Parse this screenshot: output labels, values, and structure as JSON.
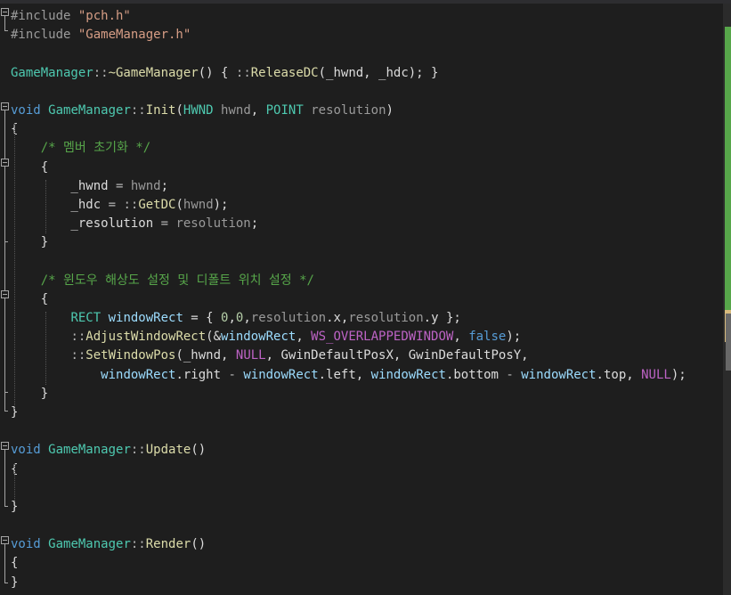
{
  "lines": [
    [
      [
        "t-pre",
        "#include "
      ],
      [
        "t-str",
        "\"pch.h\""
      ]
    ],
    [
      [
        "t-pre",
        "#include "
      ],
      [
        "t-str",
        "\"GameManager.h\""
      ]
    ],
    [],
    [
      [
        "t-type",
        "GameManager"
      ],
      [
        "t-op",
        "::"
      ],
      [
        "t-func",
        "~GameManager"
      ],
      [
        "t-def",
        "() { "
      ],
      [
        "t-op",
        "::"
      ],
      [
        "t-func",
        "ReleaseDC"
      ],
      [
        "t-def",
        "(_hwnd, _hdc); }"
      ]
    ],
    [],
    [
      [
        "t-kw",
        "void "
      ],
      [
        "t-type",
        "GameManager"
      ],
      [
        "t-op",
        "::"
      ],
      [
        "t-func",
        "Init"
      ],
      [
        "t-def",
        "("
      ],
      [
        "t-type",
        "HWND"
      ],
      [
        "t-param",
        " hwnd"
      ],
      [
        "t-def",
        ", "
      ],
      [
        "t-type",
        "POINT"
      ],
      [
        "t-param",
        " resolution"
      ],
      [
        "t-def",
        ")"
      ]
    ],
    [
      [
        "t-def",
        "{"
      ]
    ],
    [
      [
        "t-def",
        "    "
      ],
      [
        "t-cmt",
        "/* 멤버 초기화 */"
      ]
    ],
    [
      [
        "t-def",
        "    {"
      ]
    ],
    [
      [
        "t-def",
        "        _hwnd "
      ],
      [
        "t-op",
        "="
      ],
      [
        "t-param",
        " hwnd"
      ],
      [
        "t-def",
        ";"
      ]
    ],
    [
      [
        "t-def",
        "        _hdc "
      ],
      [
        "t-op",
        "="
      ],
      [
        "t-def",
        " "
      ],
      [
        "t-op",
        "::"
      ],
      [
        "t-func",
        "GetDC"
      ],
      [
        "t-def",
        "("
      ],
      [
        "t-param",
        "hwnd"
      ],
      [
        "t-def",
        ");"
      ]
    ],
    [
      [
        "t-def",
        "        _resolution "
      ],
      [
        "t-op",
        "="
      ],
      [
        "t-param",
        " resolution"
      ],
      [
        "t-def",
        ";"
      ]
    ],
    [
      [
        "t-def",
        "    }"
      ]
    ],
    [],
    [
      [
        "t-def",
        "    "
      ],
      [
        "t-cmt",
        "/* 윈도우 해상도 설정 및 디폴트 위치 설정 */"
      ]
    ],
    [
      [
        "t-def",
        "    {"
      ]
    ],
    [
      [
        "t-def",
        "        "
      ],
      [
        "t-type",
        "RECT"
      ],
      [
        "t-var",
        " windowRect"
      ],
      [
        "t-def",
        " = { "
      ],
      [
        "t-num",
        "0"
      ],
      [
        "t-def",
        ","
      ],
      [
        "t-num",
        "0"
      ],
      [
        "t-def",
        ","
      ],
      [
        "t-param",
        "resolution"
      ],
      [
        "t-def",
        ".x,"
      ],
      [
        "t-param",
        "resolution"
      ],
      [
        "t-def",
        ".y };"
      ]
    ],
    [
      [
        "t-def",
        "        "
      ],
      [
        "t-op",
        "::"
      ],
      [
        "t-func",
        "AdjustWindowRect"
      ],
      [
        "t-def",
        "(&"
      ],
      [
        "t-var",
        "windowRect"
      ],
      [
        "t-def",
        ", "
      ],
      [
        "t-macro",
        "WS_OVERLAPPEDWINDOW"
      ],
      [
        "t-def",
        ", "
      ],
      [
        "t-kw",
        "false"
      ],
      [
        "t-def",
        ");"
      ]
    ],
    [
      [
        "t-def",
        "        "
      ],
      [
        "t-op",
        "::"
      ],
      [
        "t-func",
        "SetWindowPos"
      ],
      [
        "t-def",
        "(_hwnd, "
      ],
      [
        "t-macro",
        "NULL"
      ],
      [
        "t-def",
        ", GwinDefaultPosX, GwinDefaultPosY,"
      ]
    ],
    [
      [
        "t-def",
        "            "
      ],
      [
        "t-var",
        "windowRect"
      ],
      [
        "t-def",
        ".right "
      ],
      [
        "t-op",
        "-"
      ],
      [
        "t-var",
        " windowRect"
      ],
      [
        "t-def",
        ".left, "
      ],
      [
        "t-var",
        "windowRect"
      ],
      [
        "t-def",
        ".bottom "
      ],
      [
        "t-op",
        "-"
      ],
      [
        "t-var",
        " windowRect"
      ],
      [
        "t-def",
        ".top, "
      ],
      [
        "t-macro",
        "NULL"
      ],
      [
        "t-def",
        ");"
      ]
    ],
    [
      [
        "t-def",
        "    }"
      ]
    ],
    [
      [
        "t-def",
        "}"
      ]
    ],
    [],
    [
      [
        "t-kw",
        "void "
      ],
      [
        "t-type",
        "GameManager"
      ],
      [
        "t-op",
        "::"
      ],
      [
        "t-func",
        "Update"
      ],
      [
        "t-def",
        "()"
      ]
    ],
    [
      [
        "t-def",
        "{"
      ]
    ],
    [],
    [
      [
        "t-def",
        "}"
      ]
    ],
    [],
    [
      [
        "t-kw",
        "void "
      ],
      [
        "t-type",
        "GameManager"
      ],
      [
        "t-op",
        "::"
      ],
      [
        "t-func",
        "Render"
      ],
      [
        "t-def",
        "()"
      ]
    ],
    [
      [
        "t-def",
        "{"
      ]
    ],
    [
      [
        "t-def",
        "}"
      ]
    ]
  ],
  "colors": {
    "background": "#1e1e1e",
    "keyword": "#569cd6",
    "string": "#d69d85",
    "type": "#4ec9b0",
    "function": "#dcdcaa",
    "comment": "#57a64a",
    "macro": "#bd63c5",
    "variable": "#9cdcfe",
    "parameter": "#9a9a9a",
    "number": "#b5cea8"
  },
  "icons": [
    "fold-collapse-icon"
  ]
}
